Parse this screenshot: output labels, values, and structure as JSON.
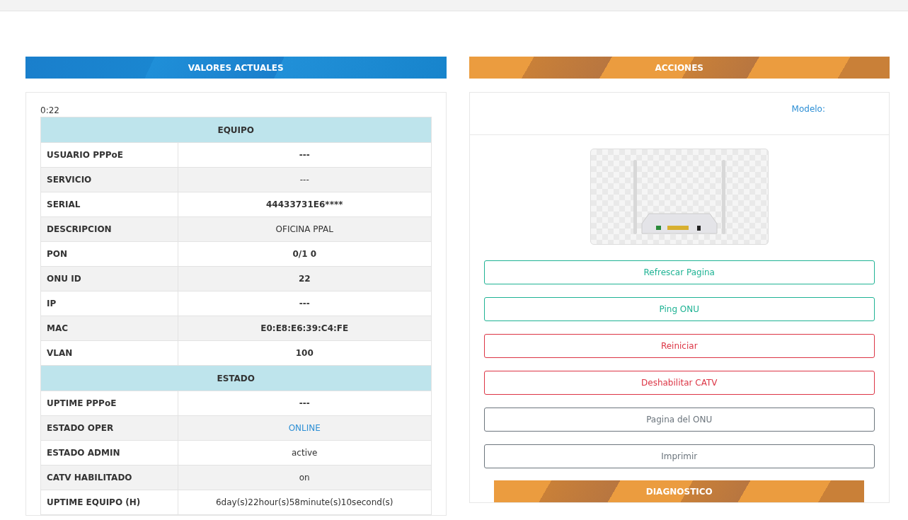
{
  "left_panel": {
    "title": "VALORES ACTUALES",
    "timer": "0:22",
    "sections": [
      {
        "title": "EQUIPO",
        "rows": [
          {
            "label": "USUARIO PPPoE",
            "value": "---",
            "kind": "bold"
          },
          {
            "label": "SERVICIO",
            "value": "---",
            "kind": "plain"
          },
          {
            "label": "SERIAL",
            "value": "44433731E6****",
            "kind": "bold"
          },
          {
            "label": "DESCRIPCION",
            "value": "OFICINA PPAL",
            "kind": "plain"
          },
          {
            "label": "PON",
            "value": "0/1 0",
            "kind": "bold"
          },
          {
            "label": "ONU ID",
            "value": "22",
            "kind": "bold"
          },
          {
            "label": "IP",
            "value": "---",
            "kind": "bold"
          },
          {
            "label": "MAC",
            "value": "E0:E8:E6:39:C4:FE",
            "kind": "bold"
          },
          {
            "label": "VLAN",
            "value": "100",
            "kind": "bold"
          }
        ]
      },
      {
        "title": "ESTADO",
        "rows": [
          {
            "label": "UPTIME PPPoE",
            "value": "---",
            "kind": "bold"
          },
          {
            "label": "ESTADO OPER",
            "value": "ONLINE",
            "kind": "link"
          },
          {
            "label": "ESTADO ADMIN",
            "value": "active",
            "kind": "plain"
          },
          {
            "label": "CATV HABILITADO",
            "value": "on",
            "kind": "plain"
          },
          {
            "label": "UPTIME EQUIPO (H)",
            "value": "6day(s)22hour(s)58minute(s)10second(s)",
            "kind": "plain"
          }
        ]
      }
    ]
  },
  "right_panel": {
    "title": "ACCIONES",
    "model_label": "Modelo:",
    "buttons": [
      {
        "label": "Refrescar Pagina",
        "kind": "success"
      },
      {
        "label": "Ping ONU",
        "kind": "success"
      },
      {
        "label": "Reiniciar",
        "kind": "danger"
      },
      {
        "label": "Deshabilitar CATV",
        "kind": "danger"
      },
      {
        "label": "Pagina del ONU",
        "kind": "secondary"
      },
      {
        "label": "Imprimir",
        "kind": "secondary"
      }
    ],
    "subtitle": "DIAGNOSTICO"
  }
}
